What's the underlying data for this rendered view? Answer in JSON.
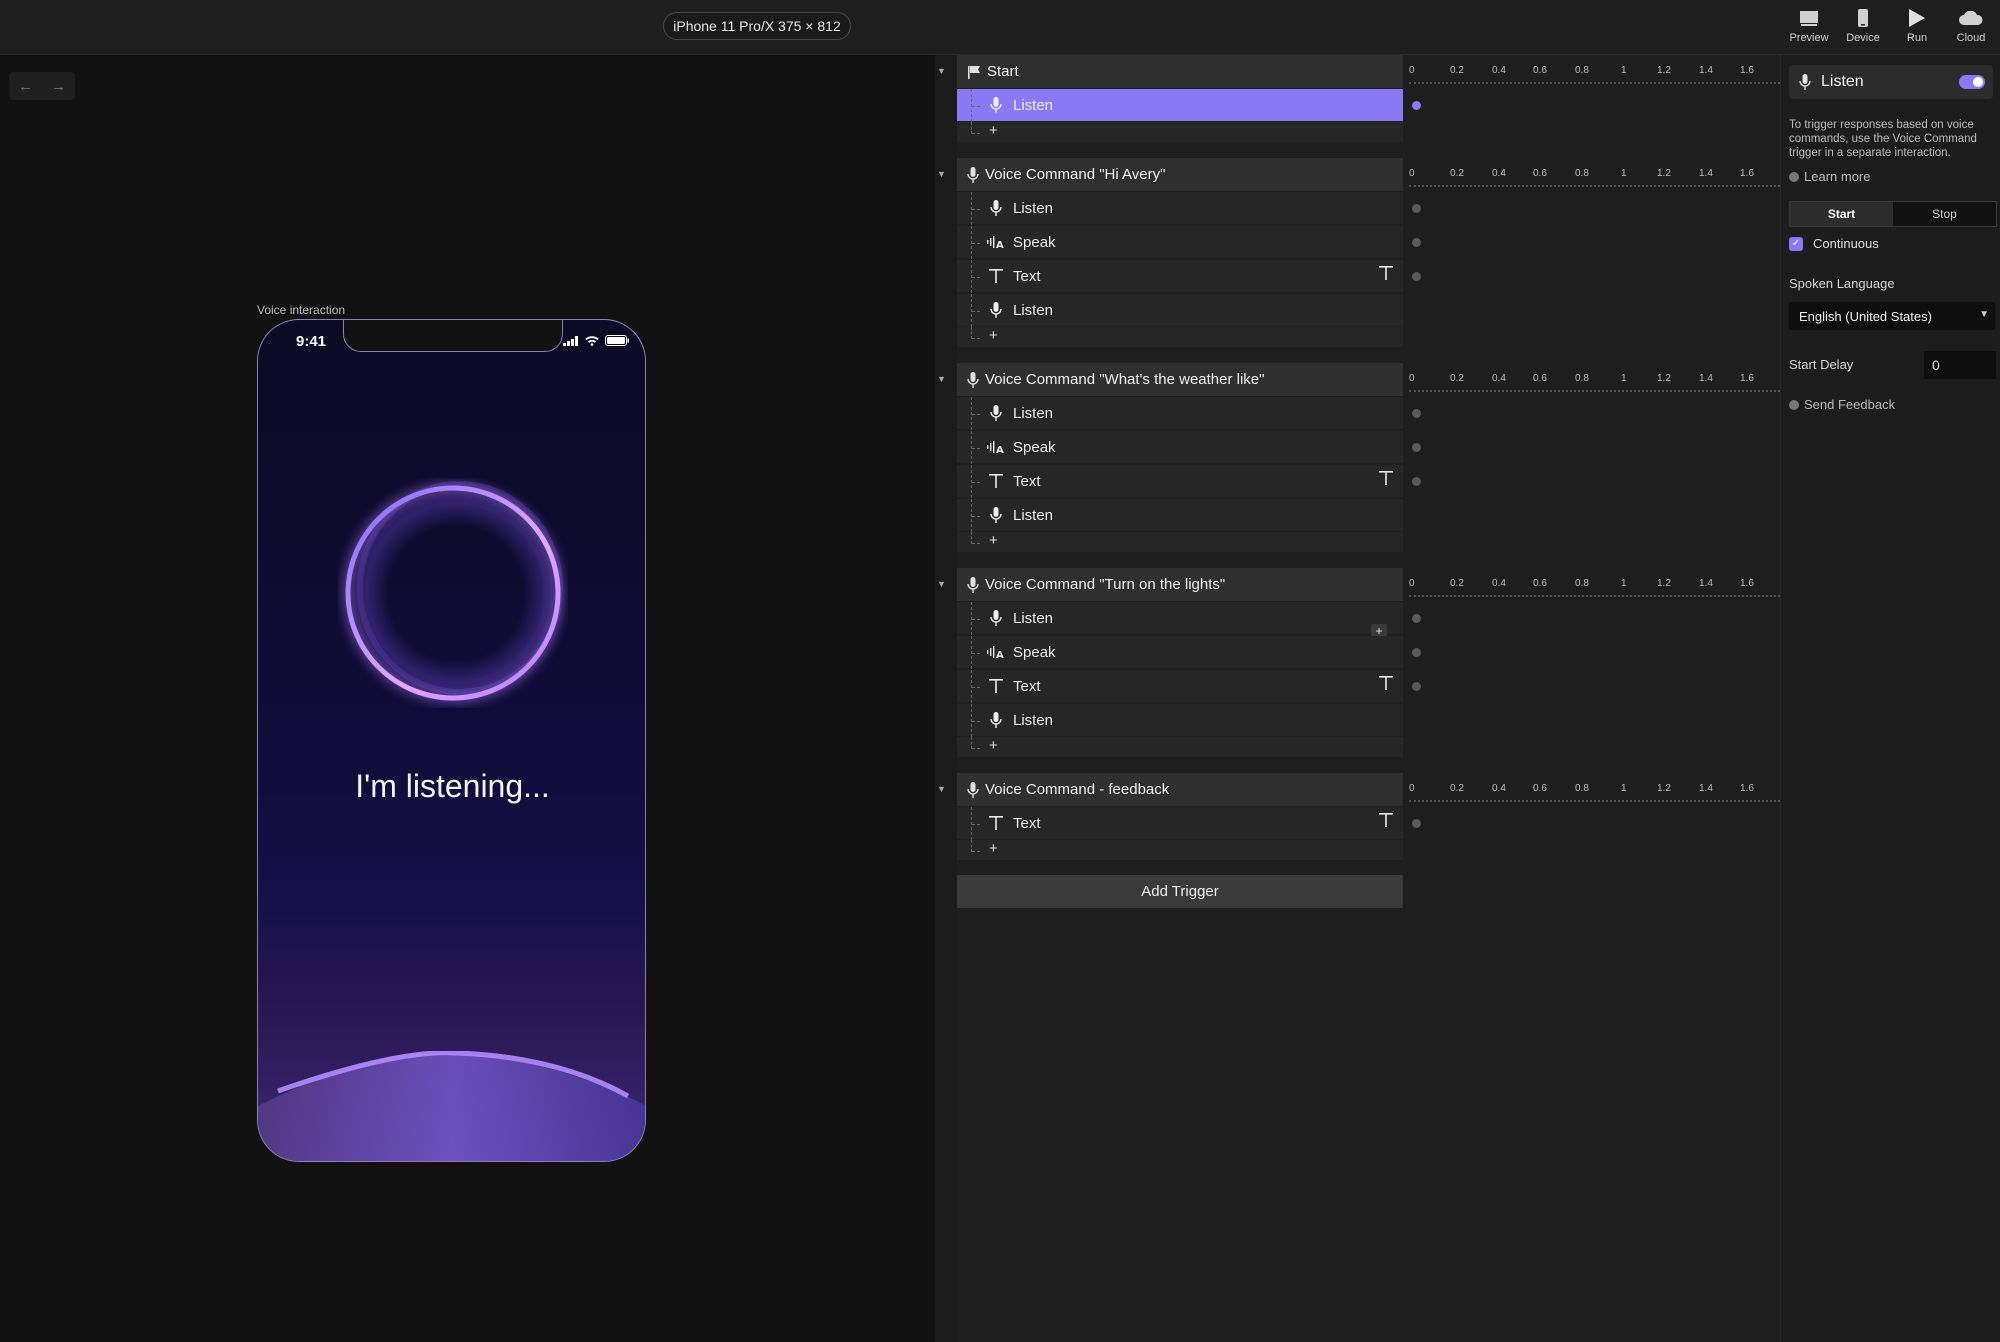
{
  "toolbar": {
    "device": "iPhone 11 Pro/X  375 × 812",
    "preview": "Preview",
    "device_btn": "Device",
    "run": "Run",
    "cloud": "Cloud"
  },
  "canvas": {
    "label": "Voice interaction",
    "phone": {
      "time": "9:41",
      "message": "I'm listening..."
    }
  },
  "ruler_ticks": [
    "0",
    "0.2",
    "0.4",
    "0.6",
    "0.8",
    "1",
    "1.2",
    "1.4",
    "1.6"
  ],
  "triggers": [
    {
      "title": "Start",
      "icon": "flag-icon",
      "rows": [
        {
          "label": "Listen",
          "icon": "mic-icon",
          "selected": true
        }
      ]
    },
    {
      "title": "Voice Command \"Hi Avery\"",
      "icon": "mic-icon",
      "rows": [
        {
          "label": "Listen",
          "icon": "mic-icon"
        },
        {
          "label": "Speak",
          "icon": "speak-icon"
        },
        {
          "label": "Text",
          "icon": "text-icon"
        },
        {
          "label": "Listen",
          "icon": "mic-icon"
        }
      ]
    },
    {
      "title": "Voice Command \"What's the weather like\"",
      "icon": "mic-icon",
      "rows": [
        {
          "label": "Listen",
          "icon": "mic-icon"
        },
        {
          "label": "Speak",
          "icon": "speak-icon"
        },
        {
          "label": "Text",
          "icon": "text-icon"
        },
        {
          "label": "Listen",
          "icon": "mic-icon"
        }
      ]
    },
    {
      "title": "Voice Command \"Turn on the lights\"",
      "icon": "mic-icon",
      "rows": [
        {
          "label": "Listen",
          "icon": "mic-icon"
        },
        {
          "label": "Speak",
          "icon": "speak-icon"
        },
        {
          "label": "Text",
          "icon": "text-icon"
        },
        {
          "label": "Listen",
          "icon": "mic-icon"
        }
      ]
    },
    {
      "title": "Voice Command - feedback",
      "icon": "mic-icon",
      "rows": [
        {
          "label": "Text",
          "icon": "text-icon"
        }
      ]
    }
  ],
  "add_trigger": "Add Trigger",
  "properties": {
    "title": "Listen",
    "description": "To trigger responses based on voice commands, use the Voice Command trigger in a separate interaction.",
    "learn_more": "Learn more",
    "seg_start": "Start",
    "seg_stop": "Stop",
    "continuous": "Continuous",
    "spoken_language_label": "Spoken Language",
    "spoken_language": "English (United States)",
    "start_delay_label": "Start Delay",
    "start_delay": "0",
    "send_feedback": "Send Feedback"
  },
  "colors": {
    "accent": "#8b78f5"
  }
}
